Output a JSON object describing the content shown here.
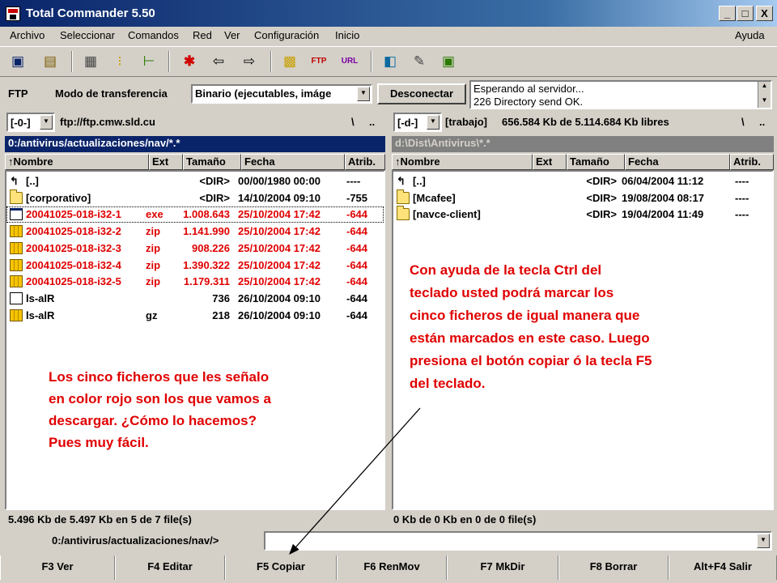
{
  "window": {
    "title": "Total Commander 5.50",
    "min_label": "_",
    "max_label": "□",
    "close_label": "X"
  },
  "menu": {
    "items": [
      "Archivo",
      "Seleccionar",
      "Comandos",
      "Red",
      "Ver",
      "Configuración",
      "Inicio"
    ],
    "help": "Ayuda"
  },
  "toolbar": {
    "icons": [
      "refresh-icon",
      "view-icon",
      "brief-icon",
      "full-icon",
      "tree-icon",
      "pack-icon",
      "back-icon",
      "forward-icon",
      "unpack-icon",
      "ftp-connect-icon",
      "ftp-new-icon",
      "compare-icon",
      "edit-icon",
      "run-icon"
    ]
  },
  "ftp": {
    "label": "FTP",
    "mode_label": "Modo de transferencia",
    "mode_value": "Binario (ejecutables, imáge",
    "disconnect_label": "Desconectar",
    "log": [
      "Esperando al servidor...",
      "226 Directory send OK."
    ]
  },
  "left": {
    "drive": "[-0-]",
    "path_label": "ftp://ftp.cmw.sld.cu",
    "root": "\\",
    "up": "..",
    "current": "0:/antivirus/actualizaciones/nav/*.*",
    "headers": {
      "name": "↑Nombre",
      "ext": "Ext",
      "size": "Tamaño",
      "date": "Fecha",
      "attr": "Atrib."
    },
    "rows": [
      {
        "icon": "up",
        "name": "[..]",
        "ext": "",
        "size": "<DIR>",
        "date": "00/00/1980 00:00",
        "attr": "----",
        "red": false
      },
      {
        "icon": "folder",
        "name": "[corporativo]",
        "ext": "",
        "size": "<DIR>",
        "date": "14/10/2004 09:10",
        "attr": "-755",
        "red": false
      },
      {
        "icon": "exe",
        "name": "20041025-018-i32-1",
        "ext": "exe",
        "size": "1.008.643",
        "date": "25/10/2004 17:42",
        "attr": "-644",
        "red": true
      },
      {
        "icon": "zip",
        "name": "20041025-018-i32-2",
        "ext": "zip",
        "size": "1.141.990",
        "date": "25/10/2004 17:42",
        "attr": "-644",
        "red": true
      },
      {
        "icon": "zip",
        "name": "20041025-018-i32-3",
        "ext": "zip",
        "size": "908.226",
        "date": "25/10/2004 17:42",
        "attr": "-644",
        "red": true
      },
      {
        "icon": "zip",
        "name": "20041025-018-i32-4",
        "ext": "zip",
        "size": "1.390.322",
        "date": "25/10/2004 17:42",
        "attr": "-644",
        "red": true
      },
      {
        "icon": "zip",
        "name": "20041025-018-i32-5",
        "ext": "zip",
        "size": "1.179.311",
        "date": "25/10/2004 17:42",
        "attr": "-644",
        "red": true
      },
      {
        "icon": "doc",
        "name": "ls-alR",
        "ext": "",
        "size": "736",
        "date": "26/10/2004 09:10",
        "attr": "-644",
        "red": false
      },
      {
        "icon": "zip",
        "name": "ls-alR",
        "ext": "gz",
        "size": "218",
        "date": "26/10/2004 09:10",
        "attr": "-644",
        "red": false
      }
    ],
    "status": "5.496 Kb de 5.497 Kb en 5 de 7 file(s)"
  },
  "right": {
    "drive": "[-d-]",
    "volume": "[trabajo]",
    "free": "656.584 Kb de 5.114.684 Kb libres",
    "root": "\\",
    "up": "..",
    "current": "d:\\Dist\\Antivirus\\*.*",
    "headers": {
      "name": "↑Nombre",
      "ext": "Ext",
      "size": "Tamaño",
      "date": "Fecha",
      "attr": "Atrib."
    },
    "rows": [
      {
        "icon": "up",
        "name": "[..]",
        "ext": "",
        "size": "<DIR>",
        "date": "06/04/2004 11:12",
        "attr": "----",
        "red": false
      },
      {
        "icon": "folder",
        "name": "[Mcafee]",
        "ext": "",
        "size": "<DIR>",
        "date": "19/08/2004 08:17",
        "attr": "----",
        "red": false
      },
      {
        "icon": "folder",
        "name": "[navce-client]",
        "ext": "",
        "size": "<DIR>",
        "date": "19/04/2004 11:49",
        "attr": "----",
        "red": false
      }
    ],
    "status": "0 Kb de 0 Kb en 0 de 0 file(s)"
  },
  "annotations": {
    "left_note": [
      "Los cinco ficheros que les señalo",
      "en color rojo son los que vamos a",
      "descargar. ¿Cómo lo hacemos?",
      "Pues muy fácil."
    ],
    "right_note": [
      "Con ayuda de la tecla Ctrl del",
      "teclado usted podrá marcar los",
      "cinco ficheros de igual manera que",
      "están marcados en este caso. Luego",
      "presiona el botón copiar ó la tecla F5",
      "del teclado."
    ]
  },
  "cmdline": {
    "prompt": "0:/antivirus/actualizaciones/nav/>",
    "value": ""
  },
  "fkeys": [
    "F3 Ver",
    "F4 Editar",
    "F5 Copiar",
    "F6 RenMov",
    "F7 MkDir",
    "F8 Borrar",
    "Alt+F4 Salir"
  ],
  "colors": {
    "highlight": "#e00000",
    "title_start": "#0a246a",
    "path_active": "#0a246a",
    "path_inactive": "#808080"
  }
}
